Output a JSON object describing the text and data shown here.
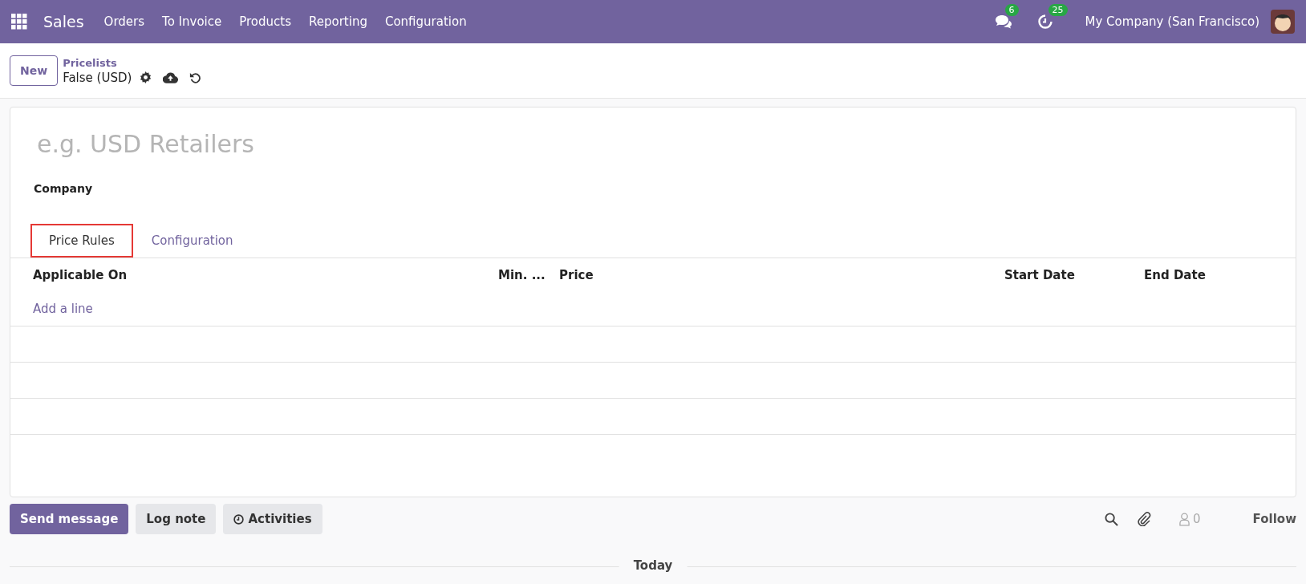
{
  "navbar": {
    "app_name": "Sales",
    "menu": [
      "Orders",
      "To Invoice",
      "Products",
      "Reporting",
      "Configuration"
    ],
    "messages_badge": "6",
    "activities_badge": "25",
    "company": "My Company (San Francisco)"
  },
  "control_panel": {
    "new_button": "New",
    "breadcrumb": "Pricelists",
    "record_name": "False (USD)"
  },
  "form": {
    "name_placeholder": "e.g. USD Retailers",
    "company_label": "Company",
    "tabs": [
      {
        "label": "Price Rules",
        "selected": true
      },
      {
        "label": "Configuration",
        "selected": false
      }
    ],
    "table": {
      "columns": [
        "Applicable On",
        "Min. ...",
        "Price",
        "Start Date",
        "End Date"
      ],
      "add_line": "Add a line"
    }
  },
  "chatter": {
    "buttons": [
      "Send message",
      "Log note",
      "Activities"
    ],
    "followers_count": "0",
    "follow": "Follow",
    "separator": "Today"
  }
}
